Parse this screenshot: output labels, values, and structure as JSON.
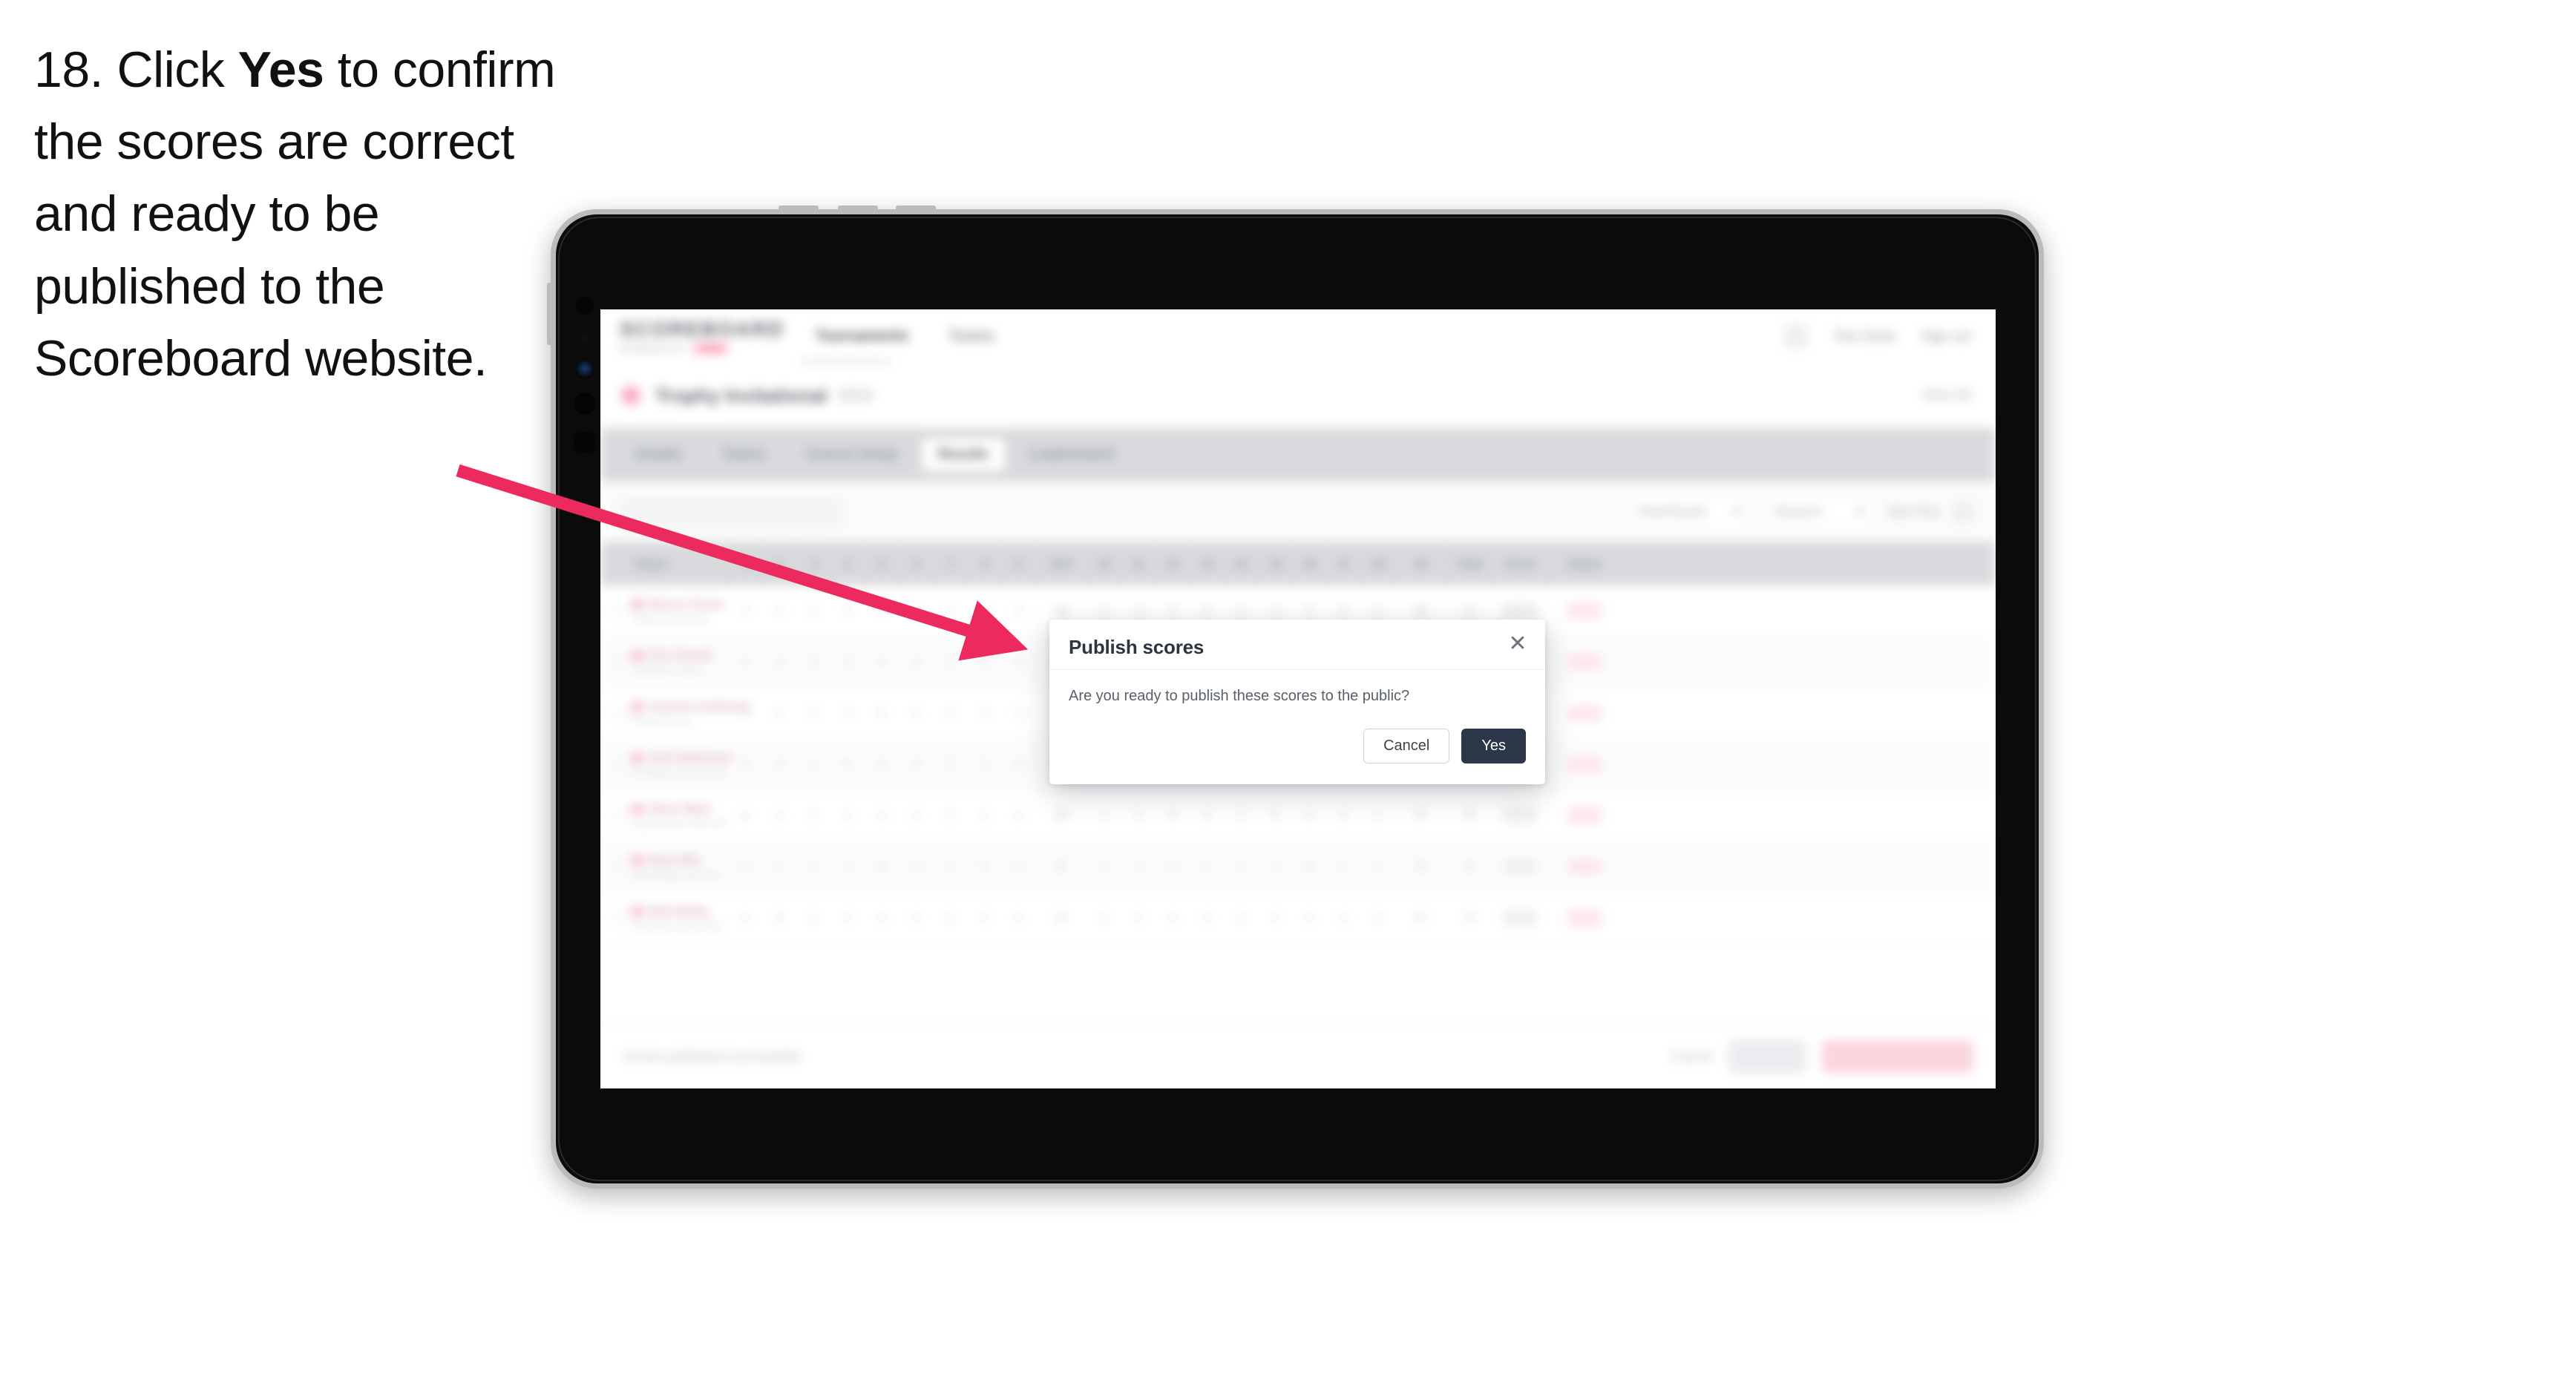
{
  "instruction": {
    "number": "18.",
    "before_bold": "Click ",
    "bold": "Yes",
    "after_bold": " to confirm the scores are correct and ready to be published to the Scoreboard website."
  },
  "app": {
    "header": {
      "logo": "SCOREBOARD",
      "logo_sub": "POWERED BY",
      "logo_badge": "ADMIN",
      "nav": [
        "Tournaments",
        "Teams"
      ],
      "active_nav": "Tournaments",
      "gear_icon": "gear-icon",
      "user_link": "Tom Davis",
      "signout_link": "Sign out"
    },
    "event": {
      "title": "Trophy Invitational",
      "subtitle": "2024",
      "right_link": "View all"
    },
    "tabs": [
      "Details",
      "Teams",
      "Course Setup",
      "Results",
      "Leaderboard"
    ],
    "active_tab": "Results",
    "filters": {
      "search_placeholder": "Search players",
      "round_select": "Final Round",
      "status_select": "Round 4",
      "sort_label": "Sort: Pos",
      "settings_icon": "settings-icon"
    },
    "table": {
      "columns": [
        "Player",
        "1",
        "2",
        "3",
        "4",
        "5",
        "6",
        "7",
        "8",
        "9",
        "OUT",
        "10",
        "11",
        "12",
        "13",
        "14",
        "15",
        "16",
        "17",
        "18",
        "IN",
        "Total",
        "Score"
      ],
      "rows": [
        {
          "name": "Marcus Turner",
          "club": "Oakmont Golf Club",
          "holes": [
            "4",
            "4",
            "3",
            "5",
            "4",
            "3",
            "4",
            "5",
            "4"
          ],
          "out": "36",
          "holes2": [
            "4",
            "3",
            "5",
            "4",
            "4",
            "3",
            "5",
            "4",
            "4"
          ],
          "in": "36",
          "total": "72",
          "score": "E",
          "status": "Complete"
        },
        {
          "name": "Finn Parnell",
          "club": "Lakeview Country",
          "holes": [
            "5",
            "4",
            "3",
            "4",
            "4",
            "4",
            "4",
            "5",
            "3"
          ],
          "out": "36",
          "holes2": [
            "4",
            "4",
            "4",
            "5",
            "3",
            "4",
            "4",
            "4",
            "5"
          ],
          "in": "37",
          "total": "73",
          "score": "+1",
          "status": "Complete"
        },
        {
          "name": "Cameron Anderson",
          "club": "Pinehurst Links",
          "holes": [
            "4",
            "5",
            "3",
            "4",
            "5",
            "3",
            "4",
            "4",
            "4"
          ],
          "out": "36",
          "holes2": [
            "5",
            "4",
            "3",
            "4",
            "4",
            "4",
            "5",
            "4",
            "4"
          ],
          "in": "37",
          "total": "73",
          "score": "+1",
          "status": "Complete"
        },
        {
          "name": "Zach Robertson",
          "club": "Brookside Country Club",
          "holes": [
            "4",
            "4",
            "4",
            "5",
            "4",
            "3",
            "5",
            "4",
            "3"
          ],
          "out": "36",
          "holes2": [
            "4",
            "5",
            "4",
            "4",
            "4",
            "3",
            "4",
            "5",
            "4"
          ],
          "in": "37",
          "total": "73",
          "score": "+1",
          "status": "Complete"
        },
        {
          "name": "Oliver Ward",
          "club": "Highland Hills Golf Club",
          "holes": [
            "5",
            "4",
            "3",
            "4",
            "4",
            "4",
            "4",
            "4",
            "4"
          ],
          "out": "36",
          "holes2": [
            "4",
            "4",
            "5",
            "4",
            "3",
            "5",
            "4",
            "4",
            "4"
          ],
          "in": "37",
          "total": "73",
          "score": "+1",
          "status": "Complete"
        },
        {
          "name": "Ryan Ellis",
          "club": "Stonebridge Golf Club",
          "holes": [
            "4",
            "4",
            "4",
            "4",
            "5",
            "3",
            "4",
            "5",
            "4"
          ],
          "out": "37",
          "holes2": [
            "4",
            "4",
            "4",
            "4",
            "4",
            "4",
            "5",
            "4",
            "4"
          ],
          "in": "37",
          "total": "74",
          "score": "+2",
          "status": "Complete"
        },
        {
          "name": "Mark Bailey",
          "club": "Riverside Country Club",
          "holes": [
            "4",
            "5",
            "3",
            "4",
            "4",
            "4",
            "5",
            "4",
            "4"
          ],
          "out": "37",
          "holes2": [
            "5",
            "4",
            "4",
            "4",
            "4",
            "4",
            "4",
            "4",
            "4"
          ],
          "in": "37",
          "total": "74",
          "score": "+2",
          "status": "Complete"
        }
      ]
    },
    "bottom": {
      "note": "Scores published successfully",
      "link": "Cancel",
      "secondary_button": "Save all",
      "primary_button": "Publish scores to public"
    }
  },
  "modal": {
    "title": "Publish scores",
    "close_icon": "close-icon",
    "body": "Are you ready to publish these scores to the public?",
    "cancel_label": "Cancel",
    "confirm_label": "Yes"
  },
  "annotation": {
    "arrow_color": "#ED2A5E",
    "arrow_name": "pointer-arrow"
  }
}
